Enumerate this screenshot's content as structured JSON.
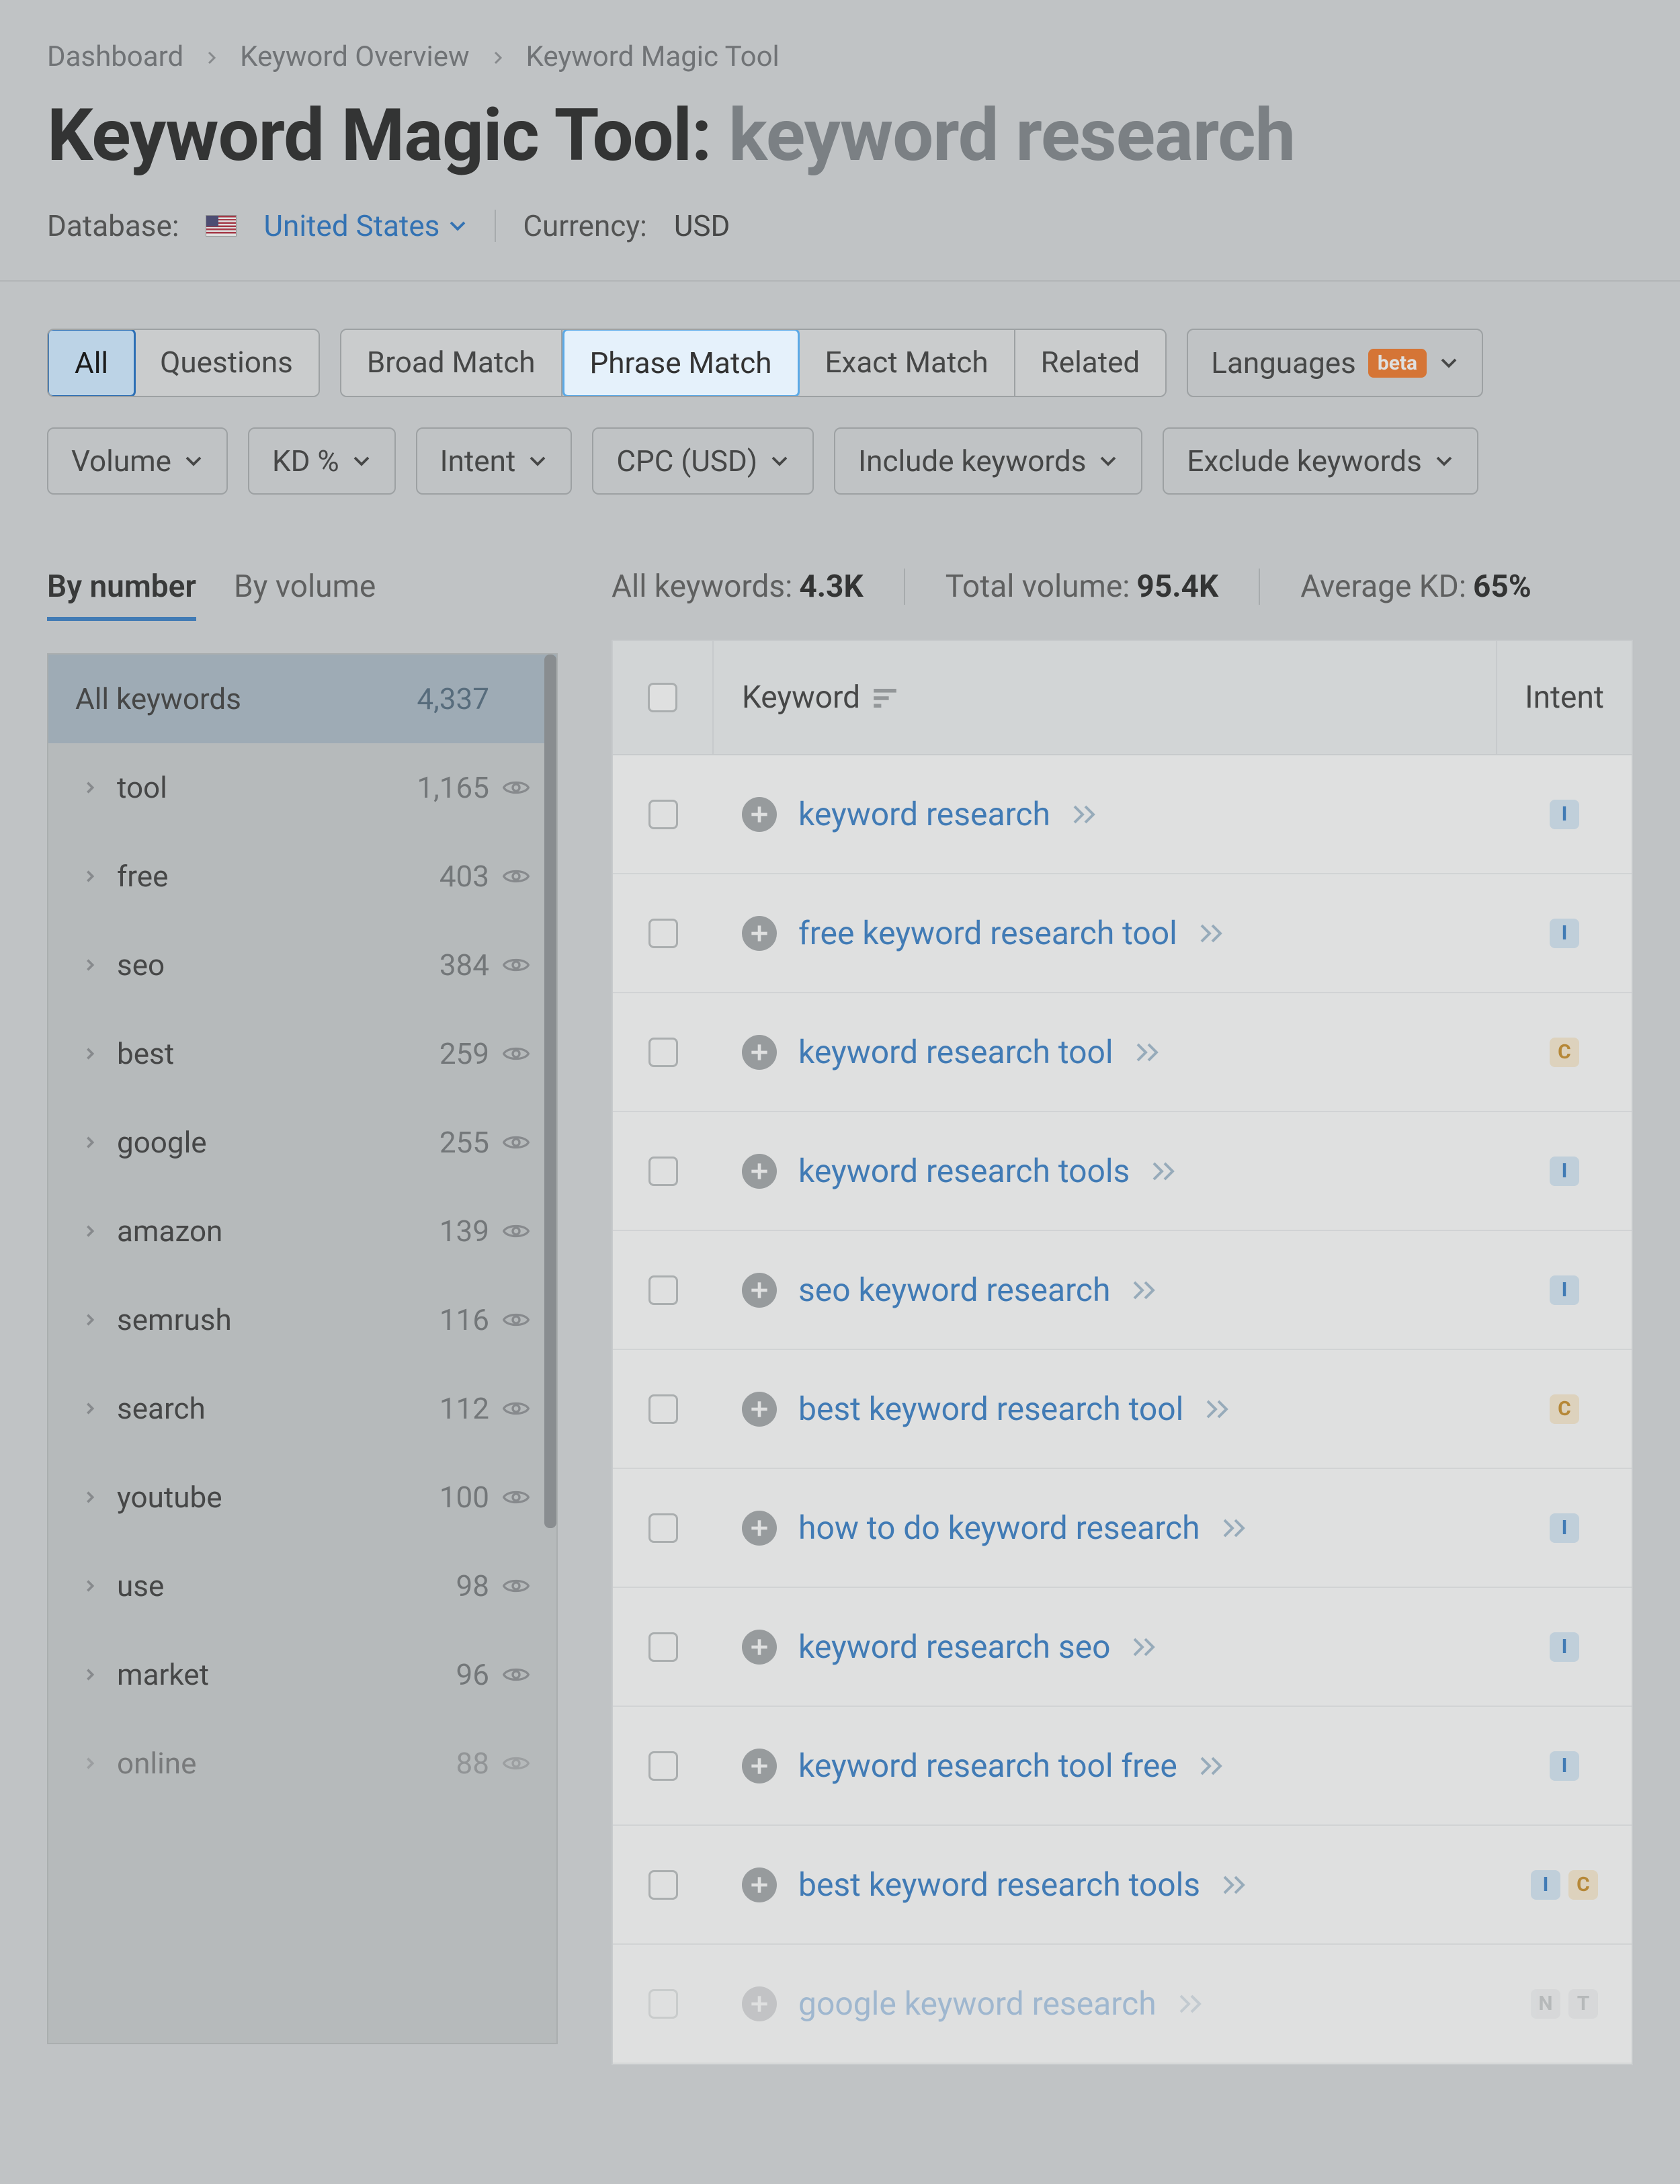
{
  "breadcrumb": [
    "Dashboard",
    "Keyword Overview",
    "Keyword Magic Tool"
  ],
  "title_prefix": "Keyword Magic Tool: ",
  "title_query": "keyword research",
  "meta": {
    "database_label": "Database:",
    "database_value": "United States",
    "currency_label": "Currency:",
    "currency_value": "USD"
  },
  "filters": {
    "scope": [
      "All",
      "Questions"
    ],
    "match": [
      "Broad Match",
      "Phrase Match",
      "Exact Match",
      "Related"
    ],
    "active_scope": "All",
    "active_match": "Phrase Match",
    "languages": "Languages",
    "beta": "beta",
    "row2": [
      "Volume",
      "KD %",
      "Intent",
      "CPC (USD)",
      "Include keywords",
      "Exclude keywords"
    ]
  },
  "sidebar": {
    "tabs": [
      "By number",
      "By volume"
    ],
    "active_tab": "By number",
    "header": {
      "label": "All keywords",
      "count": "4,337"
    },
    "items": [
      {
        "name": "tool",
        "count": "1,165"
      },
      {
        "name": "free",
        "count": "403"
      },
      {
        "name": "seo",
        "count": "384"
      },
      {
        "name": "best",
        "count": "259"
      },
      {
        "name": "google",
        "count": "255"
      },
      {
        "name": "amazon",
        "count": "139"
      },
      {
        "name": "semrush",
        "count": "116"
      },
      {
        "name": "search",
        "count": "112"
      },
      {
        "name": "youtube",
        "count": "100"
      },
      {
        "name": "use",
        "count": "98"
      },
      {
        "name": "market",
        "count": "96"
      },
      {
        "name": "online",
        "count": "88",
        "faded": true
      }
    ]
  },
  "stats": {
    "all_label": "All keywords:",
    "all_value": "4.3K",
    "vol_label": "Total volume:",
    "vol_value": "95.4K",
    "kd_label": "Average KD:",
    "kd_value": "65%"
  },
  "table": {
    "col_keyword": "Keyword",
    "col_intent": "Intent",
    "rows": [
      {
        "kw": "keyword research",
        "intents": [
          "I"
        ]
      },
      {
        "kw": "free keyword research tool",
        "intents": [
          "I"
        ]
      },
      {
        "kw": "keyword research tool",
        "intents": [
          "C"
        ]
      },
      {
        "kw": "keyword research tools",
        "intents": [
          "I"
        ]
      },
      {
        "kw": "seo keyword research",
        "intents": [
          "I"
        ]
      },
      {
        "kw": "best keyword research tool",
        "intents": [
          "C"
        ]
      },
      {
        "kw": "how to do keyword research",
        "intents": [
          "I"
        ]
      },
      {
        "kw": "keyword research seo",
        "intents": [
          "I"
        ]
      },
      {
        "kw": "keyword research tool free",
        "intents": [
          "I"
        ]
      },
      {
        "kw": "best keyword research tools",
        "intents": [
          "I",
          "C"
        ]
      },
      {
        "kw": "google keyword research",
        "intents": [
          "N",
          "T"
        ],
        "faded": true
      }
    ]
  }
}
